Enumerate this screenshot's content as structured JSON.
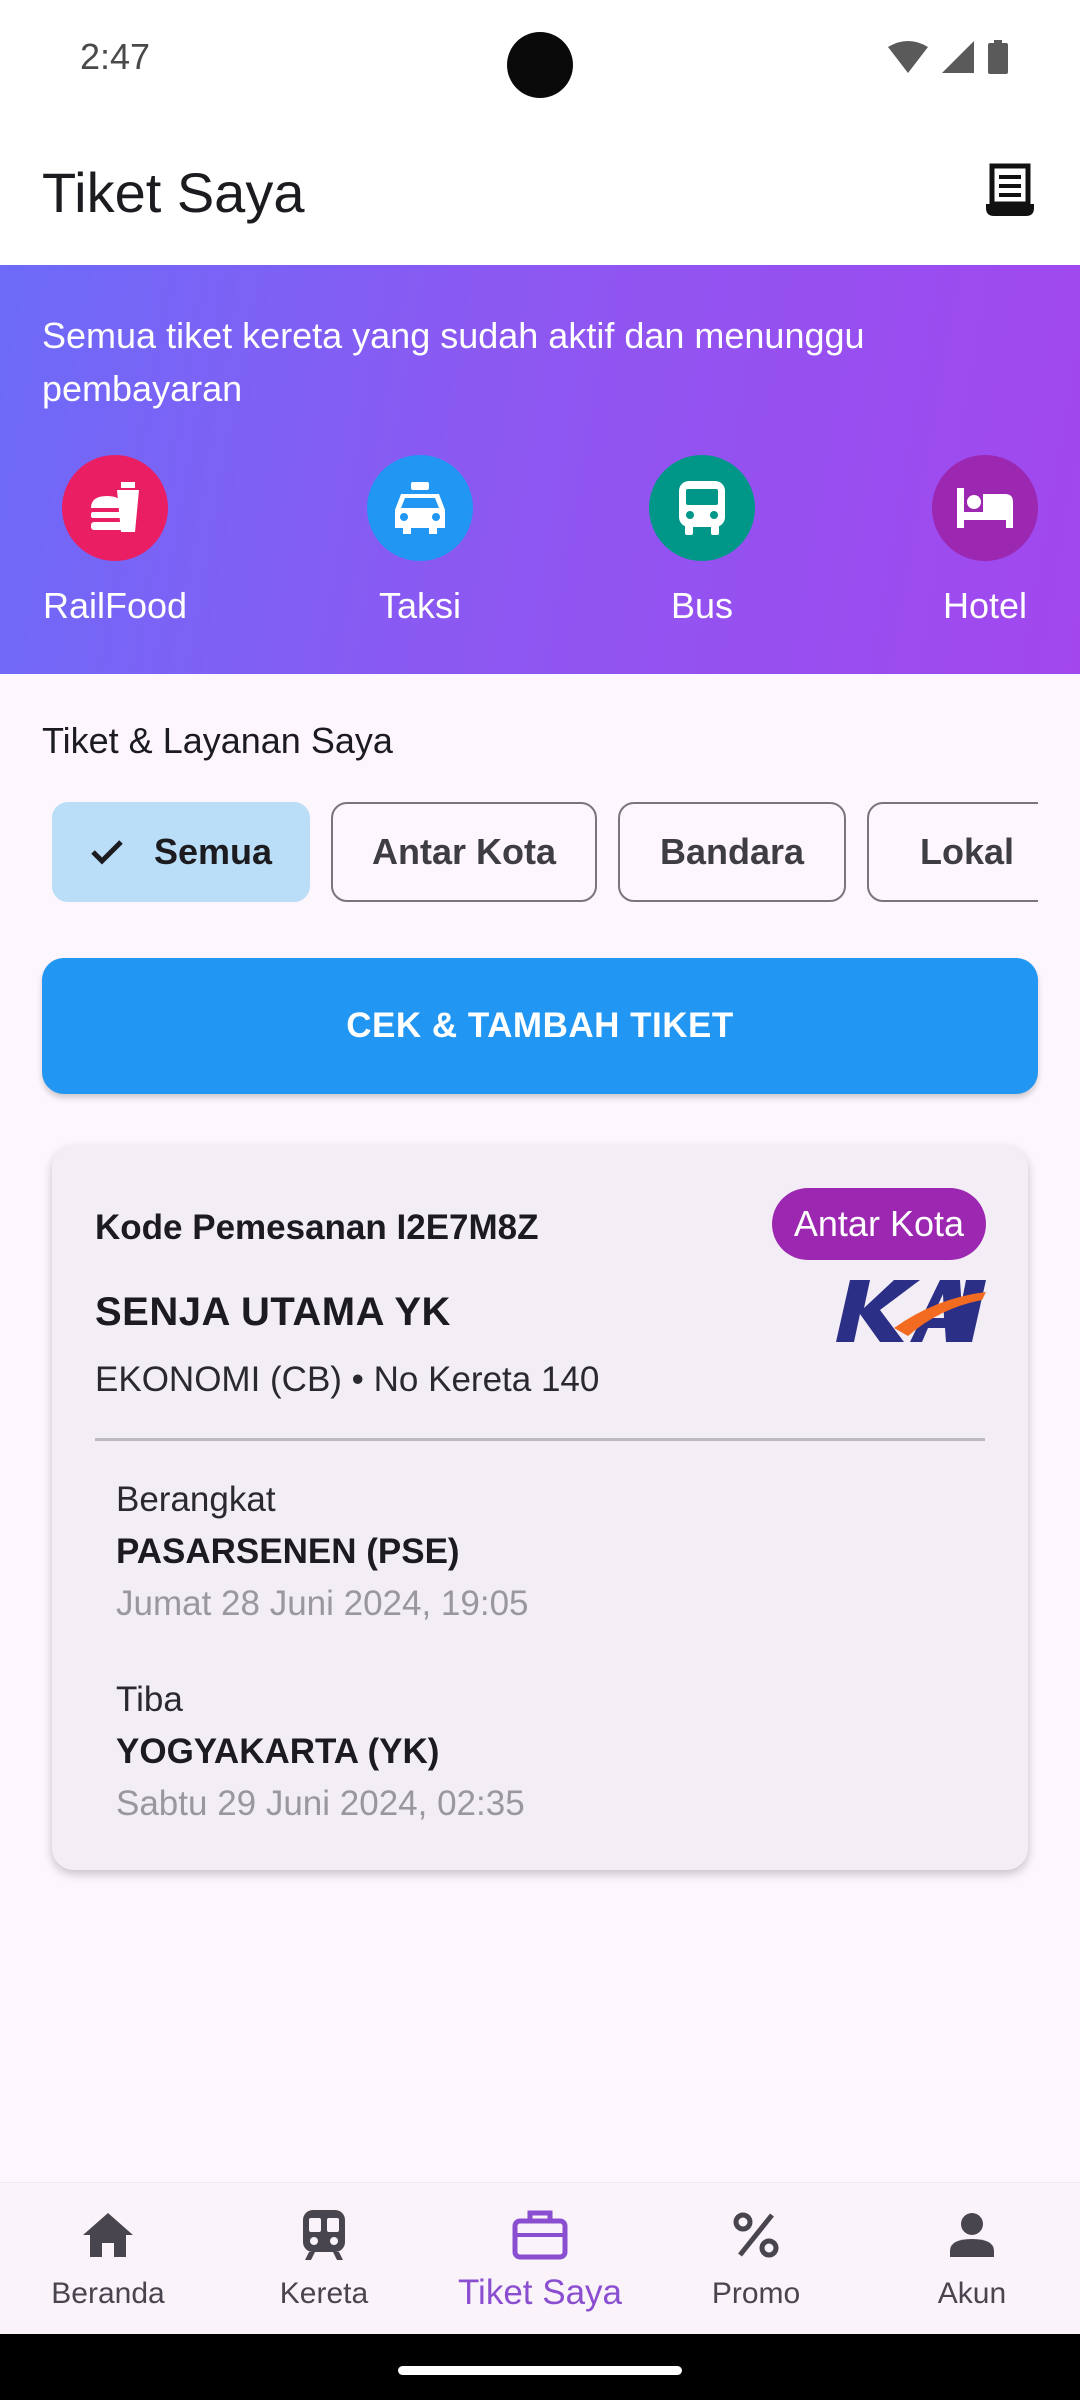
{
  "status_bar": {
    "time": "2:47"
  },
  "app_bar": {
    "title": "Tiket Saya",
    "receipt_icon": "receipt-icon"
  },
  "hero": {
    "description": "Semua tiket kereta yang sudah aktif dan menunggu pembayaran",
    "services": [
      {
        "label": "RailFood",
        "icon": "fastfood-icon",
        "color": "#E91E63"
      },
      {
        "label": "Taksi",
        "icon": "taxi-icon",
        "color": "#2196F3"
      },
      {
        "label": "Bus",
        "icon": "bus-icon",
        "color": "#009688"
      },
      {
        "label": "Hotel",
        "icon": "hotel-icon",
        "color": "#9C27B0"
      }
    ]
  },
  "section": {
    "title": "Tiket & Layanan Saya",
    "chips": [
      {
        "label": "Semua",
        "selected": true
      },
      {
        "label": "Antar Kota",
        "selected": false
      },
      {
        "label": "Bandara",
        "selected": false
      },
      {
        "label": "Lokal",
        "selected": false
      }
    ]
  },
  "cta": {
    "label": "CEK & TAMBAH TIKET"
  },
  "ticket": {
    "booking_code": "Kode Pemesanan I2E7M8Z",
    "badge": "Antar Kota",
    "train_name": "SENJA UTAMA YK",
    "operator_logo": "KAI",
    "train_class": "EKONOMI (CB) • No Kereta 140",
    "departure": {
      "label": "Berangkat",
      "station": "PASARSENEN (PSE)",
      "datetime": "Jumat 28 Juni 2024, 19:05"
    },
    "arrival": {
      "label": "Tiba",
      "station": "YOGYAKARTA (YK)",
      "datetime": "Sabtu 29 Juni 2024, 02:35"
    }
  },
  "bottom_nav": {
    "items": [
      {
        "label": "Beranda",
        "icon": "home-icon",
        "active": false
      },
      {
        "label": "Kereta",
        "icon": "train-icon",
        "active": false
      },
      {
        "label": "Tiket Saya",
        "icon": "briefcase-icon",
        "active": true
      },
      {
        "label": "Promo",
        "icon": "percent-icon",
        "active": false
      },
      {
        "label": "Akun",
        "icon": "person-icon",
        "active": false
      }
    ]
  },
  "colors": {
    "primary": "#2196F3",
    "accent_purple": "#9C27B0",
    "active_nav": "#8A4FD0",
    "chip_selected": "#BBDEF8",
    "kai_navy": "#2B2F86",
    "kai_orange": "#F26B21"
  }
}
